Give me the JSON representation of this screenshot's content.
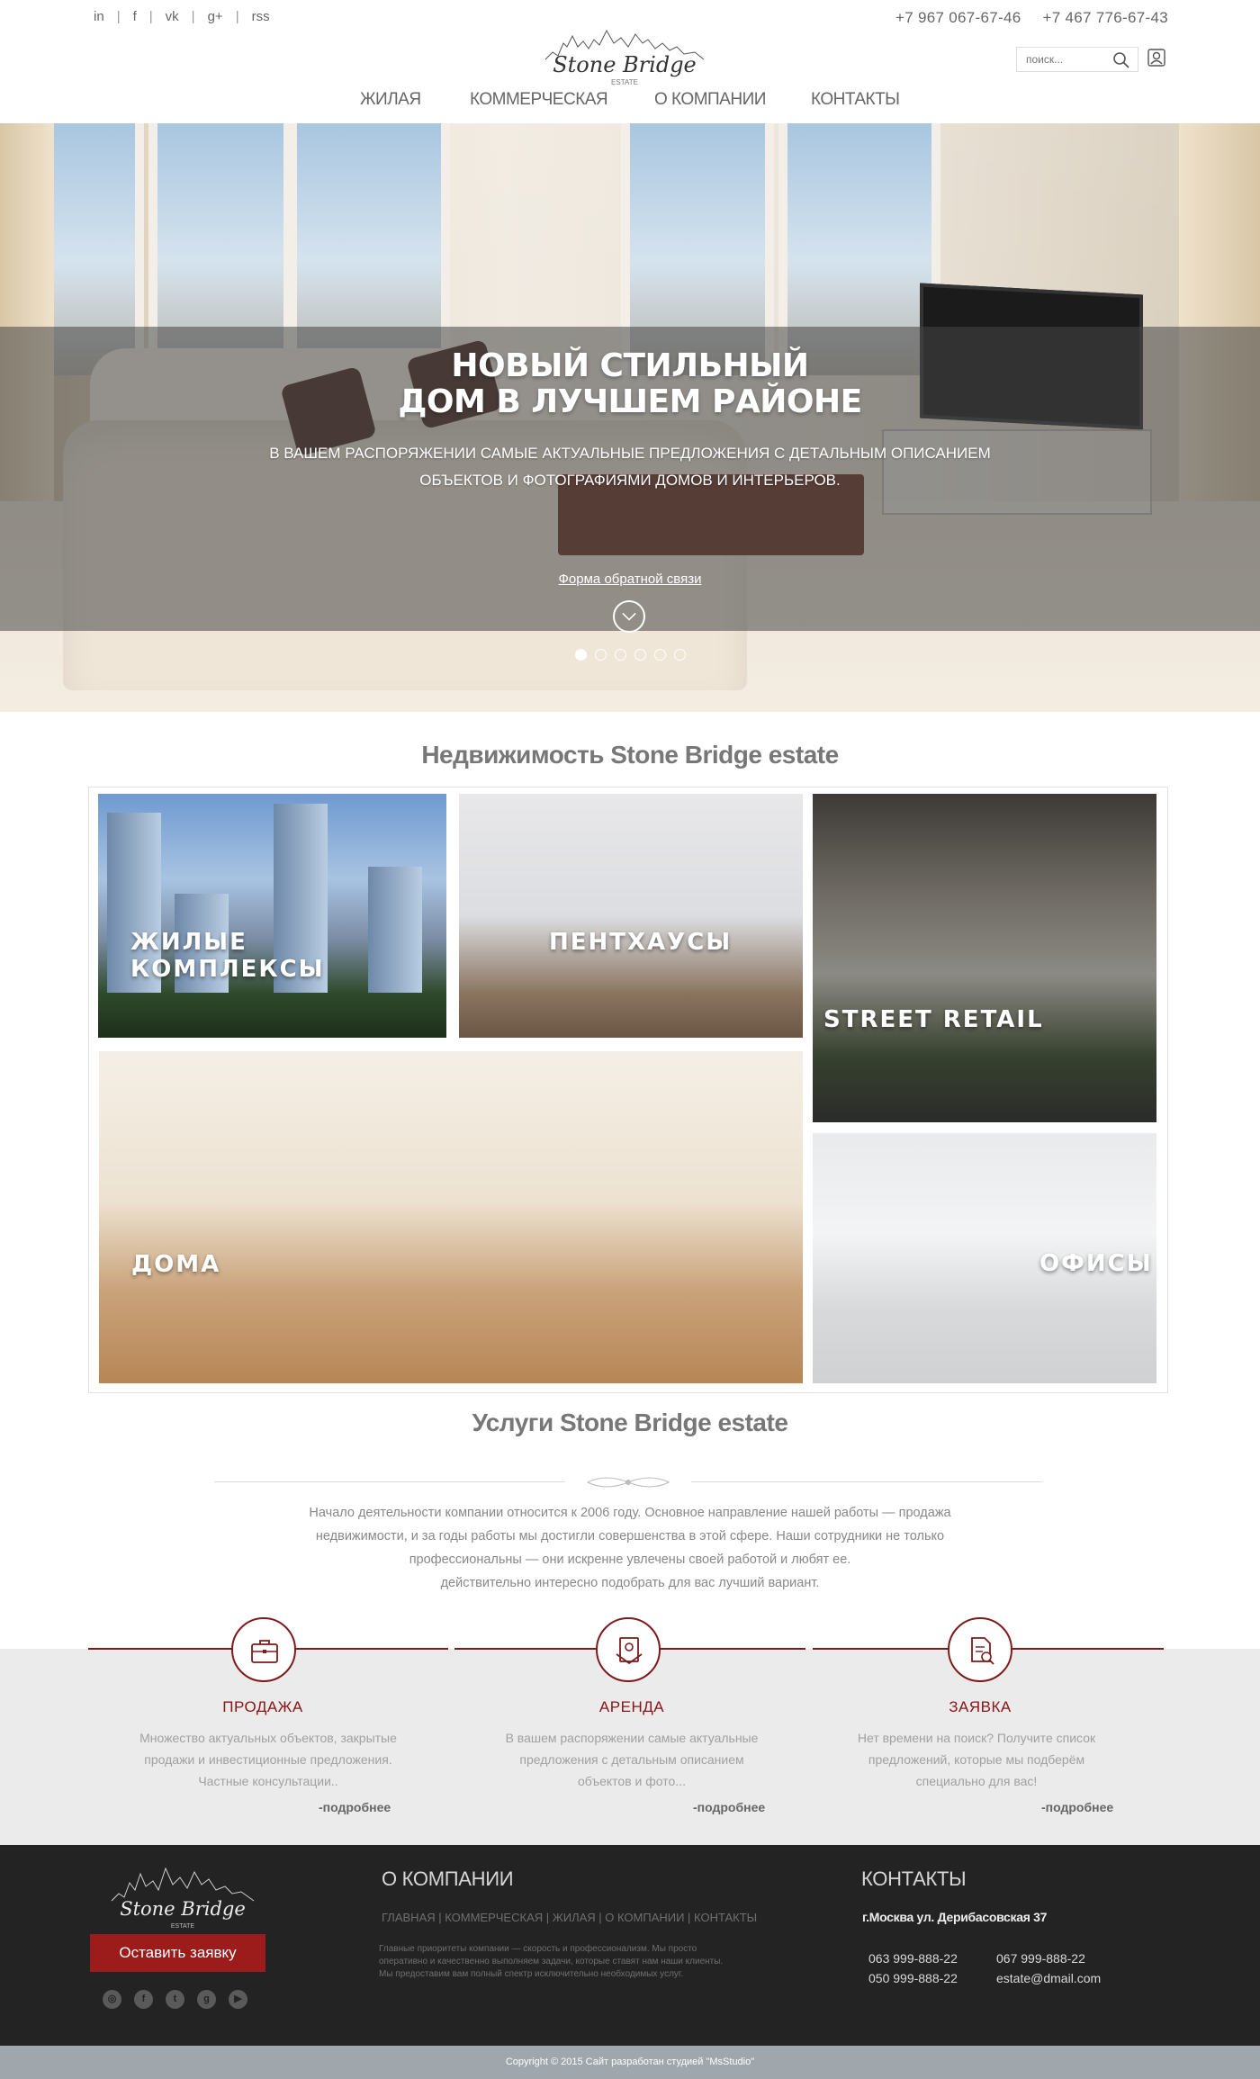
{
  "header": {
    "social": [
      "in",
      "f",
      "vk",
      "g+",
      "rss"
    ],
    "logo_text": "Stone Bridge",
    "logo_sub": "ESTATE",
    "phones": [
      "+7 967 067-67-46",
      "+7 467 776-67-43"
    ],
    "search_placeholder": "поиск...",
    "nav": [
      "ЖИЛАЯ",
      "КОММЕРЧЕСКАЯ",
      "О КОМПАНИИ",
      "КОНТАКТЫ"
    ]
  },
  "hero": {
    "title_line1": "НОВЫЙ СТИЛЬНЫЙ",
    "title_line2": "ДОМ В ЛУЧШЕМ РАЙОНЕ",
    "subtitle_line1": "В ВАШЕМ РАСПОРЯЖЕНИИ САМЫЕ АКТУАЛЬНЫЕ ПРЕДЛОЖЕНИЯ С ДЕТАЛЬНЫМ ОПИСАНИЕМ",
    "subtitle_line2": "ОБЪЕКТОВ И  ФОТОГРАФИЯМИ ДОМОВ И ИНТЕРЬЕРОВ.",
    "feedback_link": "Форма обратной связи",
    "slides_count": 6,
    "active_slide": 1
  },
  "realty": {
    "title": "Недвижимость Stone Bridge estate",
    "tiles": [
      "ЖИЛЫЕ КОМПЛЕКСЫ",
      "ПЕНТХАУСЫ",
      "STREET RETAIL",
      "ДОМА",
      "ОФИСЫ"
    ]
  },
  "services": {
    "title": "Услуги Stone Bridge estate",
    "intro_line1": "Начало деятельности компании относится к 2006 году. Основное направление нашей работы — продажа",
    "intro_line2": "недвижимости, и за годы работы мы достигли совершенства в этой сфере. Наши сотрудники не только",
    "intro_line3": "профессиональны — они искренне увлечены своей работой и любят ее.",
    "intro_line4": "действительно интересно подобрать для вас лучший вариант.",
    "items": [
      {
        "title": "ПРОДАЖА",
        "l1": "Множество актуальных объектов, закрытые",
        "l2": "продажи и инвестиционные предложения.",
        "l3": "Частные консультации..",
        "more": "-подробнее",
        "icon": "briefcase-icon"
      },
      {
        "title": "АРЕНДА",
        "l1": "В вашем распоряжении самые актуальные",
        "l2": "предложения с детальным описанием",
        "l3": "объектов и фото...",
        "more": "-подробнее",
        "icon": "contract-icon"
      },
      {
        "title": "ЗАЯВКА",
        "l1": "Нет времени на поиск? Получите список",
        "l2": "предложений, которые мы подберём",
        "l3": "специально для вас!",
        "more": "-подробнее",
        "icon": "document-search-icon"
      }
    ],
    "accent": "#7d1a1a"
  },
  "footer": {
    "order_button": "Оставить заявку",
    "social": [
      "instagram",
      "facebook",
      "twitter",
      "google",
      "youtube"
    ],
    "about_title": "О КОМПАНИИ",
    "about_nav": "ГЛАВНАЯ | КОММЕРЧЕСКАЯ  |  ЖИЛАЯ | О КОМПАНИИ | КОНТАКТЫ",
    "about_text_1": "Главные приоритеты компании — скорость и профессионализм. Мы просто",
    "about_text_2": "оперативно и качественно выполняем задачи, которые ставят нам наши клиенты.",
    "about_text_3": "Мы предоставим вам полный спектр исключительно необходимых услуг.",
    "contacts_title": "КОНТАКТЫ",
    "address": "г.Москва  ул. Дерибасовская 37",
    "phone1": "063 999-888-22",
    "phone2": "067 999-888-22",
    "phone3": "050 999-888-22",
    "email": "estate@dmail.com",
    "copyright": "Copyright © 2015  Сайт разработан студией \"MsStudio\""
  }
}
